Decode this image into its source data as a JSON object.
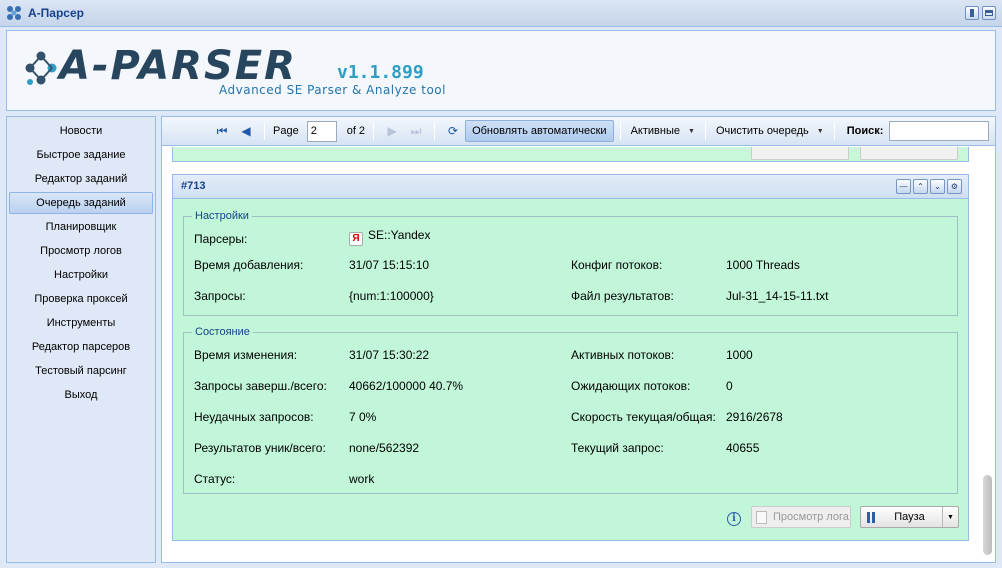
{
  "window": {
    "title": "А-Парсер"
  },
  "header": {
    "logo_text": "A-PARSER",
    "version": "v1.1.899",
    "subtitle": "Advanced SE Parser & Analyze tool"
  },
  "sidebar": {
    "items": [
      {
        "label": "Новости"
      },
      {
        "label": "Быстрое задание"
      },
      {
        "label": "Редактор заданий"
      },
      {
        "label": "Очередь заданий",
        "active": true
      },
      {
        "label": "Планировщик"
      },
      {
        "label": "Просмотр логов"
      },
      {
        "label": "Настройки"
      },
      {
        "label": "Проверка проксей"
      },
      {
        "label": "Инструменты"
      },
      {
        "label": "Редактор парсеров"
      },
      {
        "label": "Тестовый парсинг"
      },
      {
        "label": "Выход"
      }
    ]
  },
  "toolbar": {
    "page_label": "Page",
    "page_value": "2",
    "page_total": "of 2",
    "auto_refresh": "Обновлять автоматически",
    "active_dropdown": "Активные",
    "clear_queue": "Очистить очередь",
    "search_label": "Поиск:",
    "search_value": ""
  },
  "task": {
    "id": "#713",
    "settings": {
      "legend": "Настройки",
      "parsers_label": "Парсеры:",
      "parsers_value": "SE::Yandex",
      "parser_icon_letter": "Я",
      "added_label": "Время добавления:",
      "added_value": "31/07 15:15:10",
      "threads_config_label": "Конфиг потоков:",
      "threads_config_value": "1000 Threads",
      "queries_label": "Запросы:",
      "queries_value": "{num:1:100000}",
      "results_file_label": "Файл результатов:",
      "results_file_value": "Jul-31_14-15-11.txt"
    },
    "state": {
      "legend": "Состояние",
      "changed_label": "Время изменения:",
      "changed_value": "31/07 15:30:22",
      "active_threads_label": "Активных потоков:",
      "active_threads_value": "1000",
      "queries_done_label": "Запросы заверш./всего:",
      "queries_done_value": "40662/100000 40.7%",
      "waiting_threads_label": "Ожидающих потоков:",
      "waiting_threads_value": "0",
      "failed_label": "Неудачных запросов:",
      "failed_value": "7 0%",
      "speed_label": "Скорость текущая/общая:",
      "speed_value": "2916/2678",
      "results_label": "Результатов уник/всего:",
      "results_value": "none/562392",
      "current_query_label": "Текущий запрос:",
      "current_query_value": "40655",
      "status_label": "Статус:",
      "status_value": "work"
    },
    "buttons": {
      "view_log": "Просмотр лога",
      "pause": "Пауза"
    }
  },
  "colors": {
    "panel_bg": "#c1f6d8",
    "accent": "#15428b"
  }
}
